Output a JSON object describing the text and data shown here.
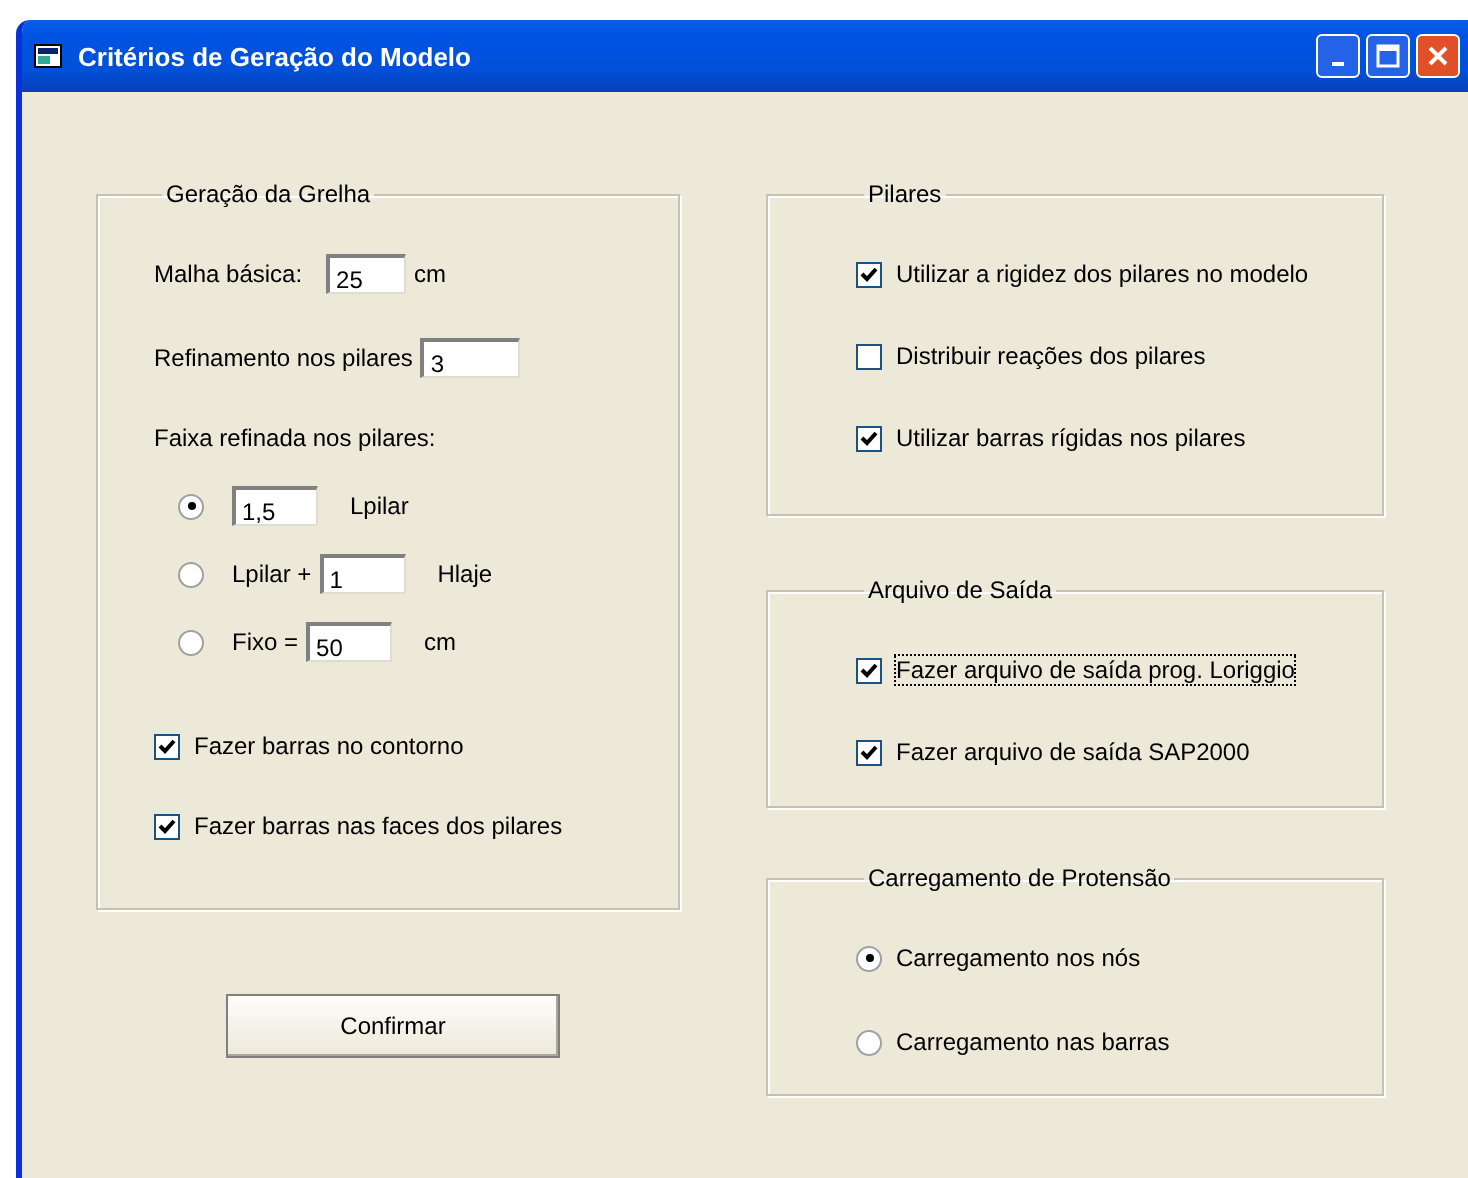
{
  "window": {
    "title": "Critérios de Geração do Modelo"
  },
  "grelha": {
    "title": "Geração da Grelha",
    "malha": {
      "label": "Malha básica:",
      "value": "25",
      "unit": "cm"
    },
    "refinamento": {
      "label": "Refinamento nos pilares",
      "value": "3"
    },
    "faixa_label": "Faixa refinada nos pilares:",
    "faixa_options": [
      {
        "selected": true,
        "value": "1,5",
        "unit": "Lpilar"
      },
      {
        "selected": false,
        "label": "Lpilar +",
        "value": "1",
        "unit": "Hlaje"
      },
      {
        "selected": false,
        "label": "Fixo =",
        "value": "50",
        "unit": "cm"
      }
    ],
    "checkboxes": [
      {
        "label": "Fazer barras no contorno",
        "checked": true
      },
      {
        "label": "Fazer barras nas faces dos pilares",
        "checked": true
      }
    ]
  },
  "pilares": {
    "title": "Pilares",
    "checkboxes": [
      {
        "label": "Utilizar a rigidez dos pilares no modelo",
        "checked": true
      },
      {
        "label": "Distribuir reações dos pilares",
        "checked": false
      },
      {
        "label": "Utilizar barras rígidas nos pilares",
        "checked": true
      }
    ]
  },
  "arquivo": {
    "title": "Arquivo de Saída",
    "checkboxes": [
      {
        "label": "Fazer arquivo de saída prog. Loriggio",
        "checked": true,
        "focused": true
      },
      {
        "label": "Fazer arquivo de saída SAP2000",
        "checked": true,
        "focused": false
      }
    ]
  },
  "carregamento": {
    "title": "Carregamento de Protensão",
    "options": [
      {
        "label": "Carregamento nos nós",
        "selected": true
      },
      {
        "label": "Carregamento nas barras",
        "selected": false
      }
    ]
  },
  "buttons": [
    {
      "label": "Confirmar"
    }
  ]
}
